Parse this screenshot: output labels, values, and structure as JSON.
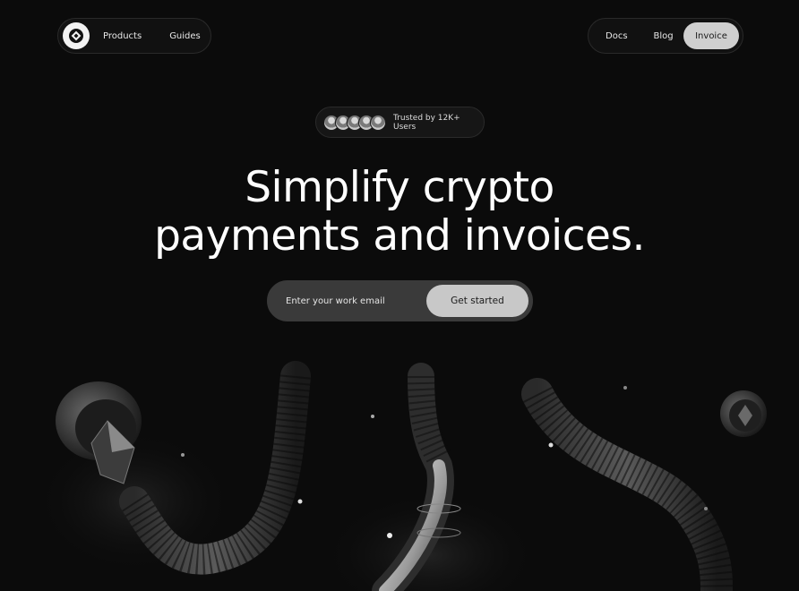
{
  "nav": {
    "left_links": [
      "Products",
      "Guides"
    ],
    "right_links": [
      "Docs",
      "Blog"
    ],
    "cta_label": "Invoice"
  },
  "trust": {
    "text": "Trusted by 12K+ Users",
    "avatar_count": 5
  },
  "hero": {
    "line1": "Simplify crypto",
    "line2": "payments and invoices."
  },
  "signup": {
    "placeholder": "Enter your work email",
    "button_label": "Get started"
  },
  "colors": {
    "background": "#0b0b0b",
    "button": "#c8c8c8",
    "pill_border": "#2a2a2a"
  }
}
